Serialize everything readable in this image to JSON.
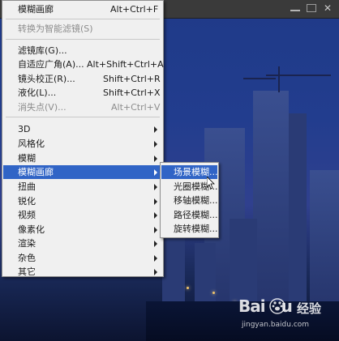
{
  "main_menu": {
    "items": [
      {
        "label": "模糊画廊",
        "shortcut": "Alt+Ctrl+F",
        "disabled": false
      },
      {
        "label": "转换为智能滤镜(S)",
        "shortcut": "",
        "disabled": true
      },
      {
        "label": "滤镜库(G)...",
        "shortcut": "",
        "disabled": false
      },
      {
        "label": "自适应广角(A)...",
        "shortcut": "Alt+Shift+Ctrl+A",
        "disabled": false
      },
      {
        "label": "镜头校正(R)...",
        "shortcut": "Shift+Ctrl+R",
        "disabled": false
      },
      {
        "label": "液化(L)...",
        "shortcut": "Shift+Ctrl+X",
        "disabled": false
      },
      {
        "label": "消失点(V)...",
        "shortcut": "Alt+Ctrl+V",
        "disabled": true
      },
      {
        "label": "3D",
        "shortcut": "",
        "disabled": false
      },
      {
        "label": "风格化",
        "shortcut": "",
        "disabled": false
      },
      {
        "label": "模糊",
        "shortcut": "",
        "disabled": false
      },
      {
        "label": "模糊画廊",
        "shortcut": "",
        "disabled": false
      },
      {
        "label": "扭曲",
        "shortcut": "",
        "disabled": false
      },
      {
        "label": "锐化",
        "shortcut": "",
        "disabled": false
      },
      {
        "label": "视频",
        "shortcut": "",
        "disabled": false
      },
      {
        "label": "像素化",
        "shortcut": "",
        "disabled": false
      },
      {
        "label": "渲染",
        "shortcut": "",
        "disabled": false
      },
      {
        "label": "杂色",
        "shortcut": "",
        "disabled": false
      },
      {
        "label": "其它",
        "shortcut": "",
        "disabled": false
      }
    ]
  },
  "sub_menu": {
    "items": [
      {
        "label": "场景模糊..."
      },
      {
        "label": "光圈模糊..."
      },
      {
        "label": "移轴模糊..."
      },
      {
        "label": "路径模糊..."
      },
      {
        "label": "旋转模糊..."
      }
    ]
  },
  "watermark": {
    "logo": "Bai",
    "logo_tail": "u",
    "jingyan": "经验",
    "url": "jingyan.baidu.com"
  },
  "colors": {
    "menu_bg": "#f0f0f0",
    "highlight": "#3064c6",
    "disabled_text": "#8d8d8d"
  }
}
